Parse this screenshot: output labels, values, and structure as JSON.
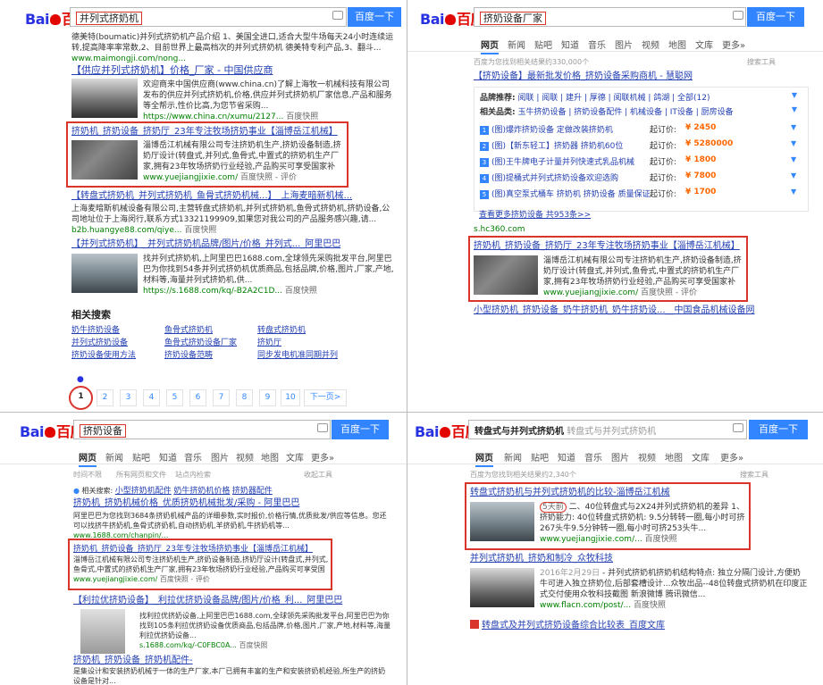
{
  "brand": {
    "bai": "Bai",
    "du": "百度"
  },
  "search_button": "百度一下",
  "panel_tl": {
    "query": "并列式挤奶机",
    "top_snippet": "德美特(boumatic)并列式挤奶机产品介绍 1、美国全进口,适合大型牛场每天24小时连续运转,提高降率率常数,2、目前世界上最高档次的并列式挤奶机 德美特专利产品,3、翻斗...",
    "top_url": "www.maimongji.com/nong...",
    "results": [
      {
        "title": "【供应并列式挤奶机】价格_厂家 - 中国供应商",
        "text": "欢迎商来中国供应商(www.china.cn)了解上海牧一机械科技有限公司发布的供应并列式挤奶机,价格,供应并列式挤奶机厂家信息,产品和服务等全帮示,性价比高,为您节省采购...",
        "url": "https://www.china.cn/xumu/2127...",
        "extra": "百度快照"
      },
      {
        "title": "挤奶机_挤奶设备_挤奶厅_23年专注牧场挤奶事业【淄博岳江机械】",
        "text": "淄博岳江机械有限公司专注挤奶机生产,挤奶设备制造,挤奶厅设计(转盘式,并列式,鱼骨式,中置式的挤奶机生产厂家,拥有23年牧场挤奶行业经验,产品购买可享受国家补贴。",
        "url": "www.yuejiangjixie.com/",
        "extra": "百度快照 - 评价"
      },
      {
        "title": "【转盘式挤奶机_并列式挤奶机_鱼骨式挤奶机械...】_上海麦暗新机械...",
        "text": "上海麦暗斯机械设备有限公司,主营转盘式挤奶机,并列式挤奶机,鱼骨式挤奶机,挤奶设备,公司地址位于上海闵行,联系方式13321199909,如果您对我公司的产品服务感兴趣,请...",
        "url": "b2b.huangye88.com/qiye...",
        "extra": "百度快照"
      },
      {
        "title": "【并列式挤奶机】_并列式挤奶机品牌/图片/价格_并列式..._阿里巴巴",
        "text": "找并列式挤奶机,上阿里巴巴1688.com,全球领先采购批发平台,阿里巴巴为你找到54条并列式挤奶机优质商品,包括品牌,价格,图片,厂家,产地,材料等,海量并列式挤奶机,供...",
        "url": "https://s.1688.com/kq/-B2A2C1D...",
        "extra": "百度快照"
      }
    ],
    "related_title": "相关搜索",
    "related": [
      "奶牛挤奶设备",
      "鱼骨式挤奶机",
      "转盘式挤奶机",
      "并列式挤奶设备",
      "鱼骨式挤奶设备厂家",
      "挤奶厅",
      "挤奶设备使用方法",
      "挤奶设备范畴",
      "同步发电机准同期并列"
    ],
    "pages": [
      "1",
      "2",
      "3",
      "4",
      "5",
      "6",
      "7",
      "8",
      "9",
      "10"
    ],
    "next": "下一页>"
  },
  "panel_tr": {
    "query": "挤奶设备厂家",
    "tabs": [
      "网页",
      "新闻",
      "贴吧",
      "知道",
      "音乐",
      "图片",
      "视频",
      "地图",
      "文库",
      "更多»"
    ],
    "count": "百度为您找到相关结果约330,000个",
    "tools": "搜索工具",
    "ad_title": "【挤奶设备】最新批发价格_挤奶设备采购商机 - 慧聪网",
    "ad_cat1_label": "品牌推荐:",
    "ad_cat1": "阅联 | 阅联 | 建升 | 厚德 | 阅联机械 | 鸽湖 | 全部(12)",
    "ad_cat2_label": "相关品类:",
    "ad_cat2": "玉牛挤奶设备 | 挤奶设备配件 | 机械设备 | IT设备 | 厨房设备",
    "ad_items": [
      {
        "n": "1",
        "name": "(图)爆炸挤奶设备 定做改装挤奶机",
        "price_label": "起订价:",
        "price": "¥ 2450"
      },
      {
        "n": "2",
        "name": "(图)【新东轻工】挤奶器 挤奶机60位",
        "price_label": "起订价:",
        "price": "¥ 5280000"
      },
      {
        "n": "3",
        "name": "(图)王牛牌电子计量并列快速式乳品机械",
        "price_label": "起订价:",
        "price": "¥ 1800"
      },
      {
        "n": "4",
        "name": "(图)提桶式并列式挤奶设备欢迎选购",
        "price_label": "起订价:",
        "price": "¥ 7800"
      },
      {
        "n": "5",
        "name": "(图)真空泵式桶车 挤奶机 挤奶设备 质量保证",
        "price_label": "起订价:",
        "price": "¥ 1700"
      }
    ],
    "ad_more": "查看更多挤奶设备 共953条>>",
    "ad_url": "s.hc360.com",
    "result": {
      "title": "挤奶机_挤奶设备_挤奶厅_23年专注牧场挤奶事业【淄博岳江机械】",
      "text": "淄博岳江机械有限公司专注挤奶机生产,挤奶设备制造,挤奶厅设计(转盘式,并列式,鱼骨式,中置式的挤奶机生产厂家,拥有23年牧场挤奶行业经验,产品购买可享受国家补贴。",
      "url": "www.yuejiangjixie.com/",
      "extra": "百度快照 - 评价"
    },
    "last": "小型挤奶机_挤奶设备_奶牛挤奶机_奶牛挤奶设...__中国食品机械设备网"
  },
  "panel_bl": {
    "query": "挤奶设备",
    "tabs": [
      "网页",
      "新闻",
      "贴吧",
      "知道",
      "音乐",
      "图片",
      "视频",
      "地图",
      "文库",
      "更多»"
    ],
    "filters": [
      "时间不限",
      "所有网页和文件",
      "站点内检索"
    ],
    "collapse": "收起工具",
    "related_label": "相关搜索:",
    "related": [
      "小型挤奶机配件",
      "奶牛挤奶机价格",
      "挤奶器配件"
    ],
    "results": [
      {
        "title": "挤奶机_挤奶机械价格_优质挤奶机械批发/采购 - 阿里巴巴",
        "text": "阿里巴巴为您找到3684条挤奶机械产品的详细参数,实时报价,价格行情,优质批发/供应等信息。您还可以找挤牛挤奶机,鱼骨式挤奶机,自动挤奶机,羊挤奶机,牛挤奶机等...",
        "url": "www.1688.com/chanpin/...",
        "extra": ""
      },
      {
        "title": "挤奶机_挤奶设备_挤奶厅_23年专注牧场挤奶事业【淄博岳江机械】",
        "text": "淄博岳江机械有限公司专注挤奶机生产,挤奶设备制造,挤奶厅设计(转盘式,并列式,鱼骨式,中置式的挤奶机生产厂家,拥有23年牧场挤奶行业经验,产品购买可享受国家补贴。",
        "url": "www.yuejiangjixie.com/",
        "extra": "百度快照 - 评价"
      },
      {
        "title": "【利拉优挤奶设备】_利拉优挤奶设备品牌/图片/价格_利..._阿里巴巴",
        "text": "找利拉优挤奶设备,上阿里巴巴1688.com,全球领先采购批发平台,阿里巴巴为你找到105条利拉优挤奶设备优质商品,包括品牌,价格,图片,厂家,产地,材料等,海量利拉优挤奶设备...",
        "url": "s.1688.com/kq/-C0FBC0A...",
        "extra": "百度快照"
      },
      {
        "title": "挤奶机_挤奶设备_挤奶机配件-",
        "text": "是集设计和安装挤奶机械于一体的生产厂家,本厂已拥有丰富的生产和安装挤奶机经验,所生产的挤奶设备是针对...",
        "url": "",
        "extra": ""
      }
    ]
  },
  "panel_br": {
    "query": "转盘式与并列式挤奶机",
    "query_hint": "转盘式与并列式挤奶机",
    "tabs": [
      "网页",
      "新闻",
      "贴吧",
      "知道",
      "音乐",
      "图片",
      "视频",
      "地图",
      "文库",
      "更多»"
    ],
    "count": "百度为您找到相关结果约2,340个",
    "tools": "搜索工具",
    "results": [
      {
        "title": "转盘式挤奶机与并列式挤奶机的比较-淄博岳江机械",
        "date": "5天前",
        "text": "二、40位转盘式与2X24并列式挤奶机的差异 1、挤奶能力: 40位转盘式挤奶机: 9.5分转转一圈,每小时可挤267头牛9.5分钟转一圈,每小时可挤253头牛...",
        "url": "www.yuejiangjixie.com/...",
        "extra": "百度快照"
      },
      {
        "title": "并列式挤奶机_挤奶和制冷_众牧科技",
        "date": "2016年2月29日",
        "text": "- 并列式挤奶机挤奶机结构特点: 独立分隔门设计,方便奶牛可进入独立挤奶位,后部套槽设计...众牧出品--48位转盘式挤奶机在印度正式交付使用众牧科技截图 新浪微博 腾讯微信...",
        "url": "www.flacn.com/post/...",
        "extra": "百度快照"
      },
      {
        "title": "转盘式及并列式挤奶设备综合比较表_百度文库",
        "date": "",
        "text": "",
        "url": "",
        "extra": ""
      }
    ]
  }
}
